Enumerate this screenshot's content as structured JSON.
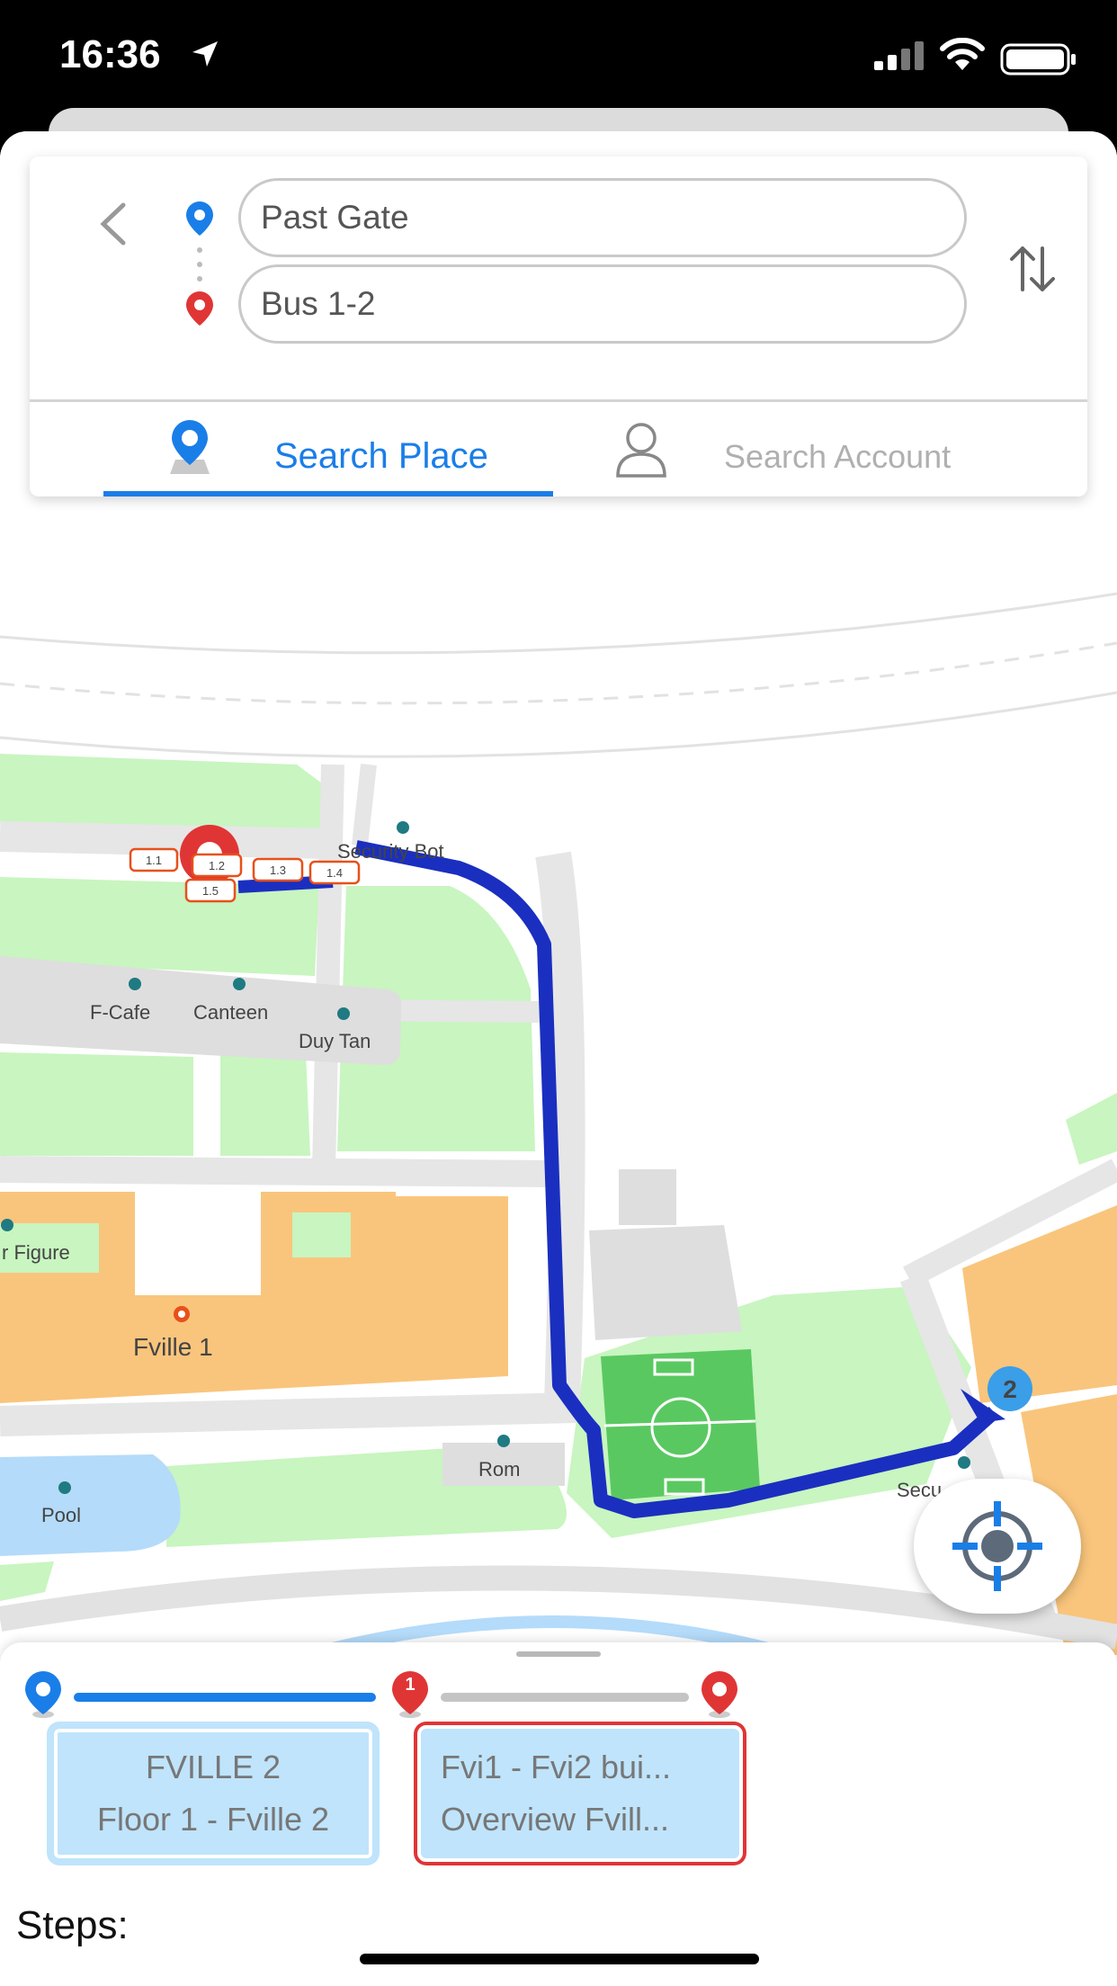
{
  "status_bar": {
    "time": "16:36"
  },
  "route": {
    "from_value": "Past Gate",
    "to_value": "Bus 1-2"
  },
  "tabs": [
    {
      "label": "Search Place",
      "active": true
    },
    {
      "label": "Search Account",
      "active": false
    }
  ],
  "map": {
    "labels": {
      "security_bot": "Security Bot",
      "f_cafe": "F-Cafe",
      "canteen": "Canteen",
      "duy_tan": "Duy Tan",
      "figure": "r Figure",
      "fville1": "Fville 1",
      "rom": "Rom",
      "pool": "Pool",
      "security_right": "Secu"
    },
    "bus_stops": [
      "1.1",
      "1.2",
      "1.3",
      "1.4",
      "1.5"
    ],
    "destination_marker": "2",
    "route_color": "#1a2fc0"
  },
  "progress": {
    "mid_stop": "1"
  },
  "buildings": [
    {
      "line1": "FVILLE 2",
      "line2": "Floor 1 - Fville 2",
      "selected": false
    },
    {
      "line1": "Fvi1 - Fvi2 bui...",
      "line2": "Overview Fvill...",
      "selected": true
    }
  ],
  "steps_label": "Steps:",
  "colors": {
    "accent": "#1a7ee8",
    "pin_red": "#e03535",
    "bus_orange": "#e8501a",
    "building_orange": "#f9c57c",
    "park_green": "#c8f5c0",
    "road_gray": "#e6e6e6"
  }
}
